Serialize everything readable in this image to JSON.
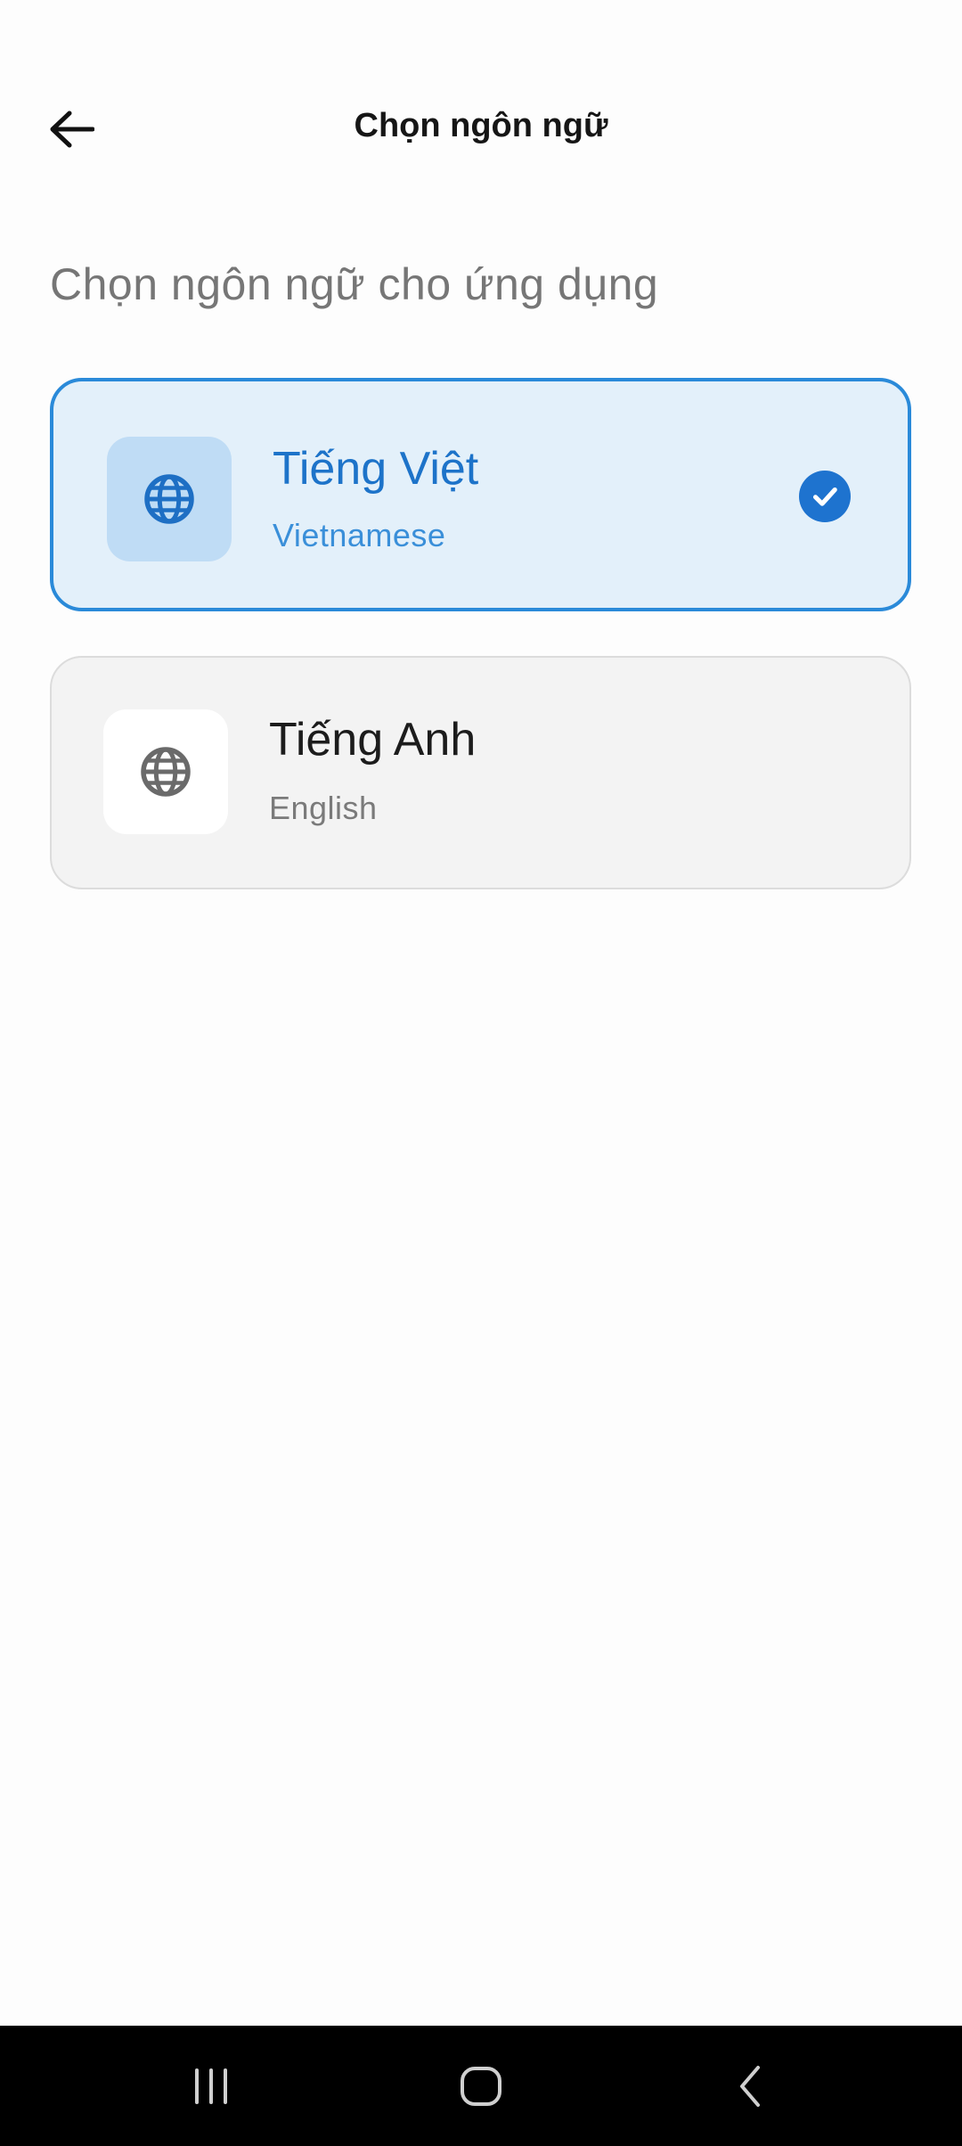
{
  "header": {
    "title": "Chọn ngôn ngữ",
    "back_icon": "arrow-left-icon"
  },
  "subtitle": "Chọn ngôn ngữ cho ứng dụng",
  "languages": [
    {
      "name": "Tiếng Việt",
      "subtitle": "Vietnamese",
      "selected": true,
      "icon": "globe-icon"
    },
    {
      "name": "Tiếng Anh",
      "subtitle": "English",
      "selected": false,
      "icon": "globe-icon"
    }
  ],
  "colors": {
    "accent": "#1e73cf",
    "selected_bg": "#e3f0fa",
    "selected_border": "#2a8ad9",
    "unselected_bg": "#f3f3f3"
  },
  "navbar": {
    "recents_icon": "recents-icon",
    "home_icon": "home-icon",
    "back_icon": "nav-back-icon"
  }
}
